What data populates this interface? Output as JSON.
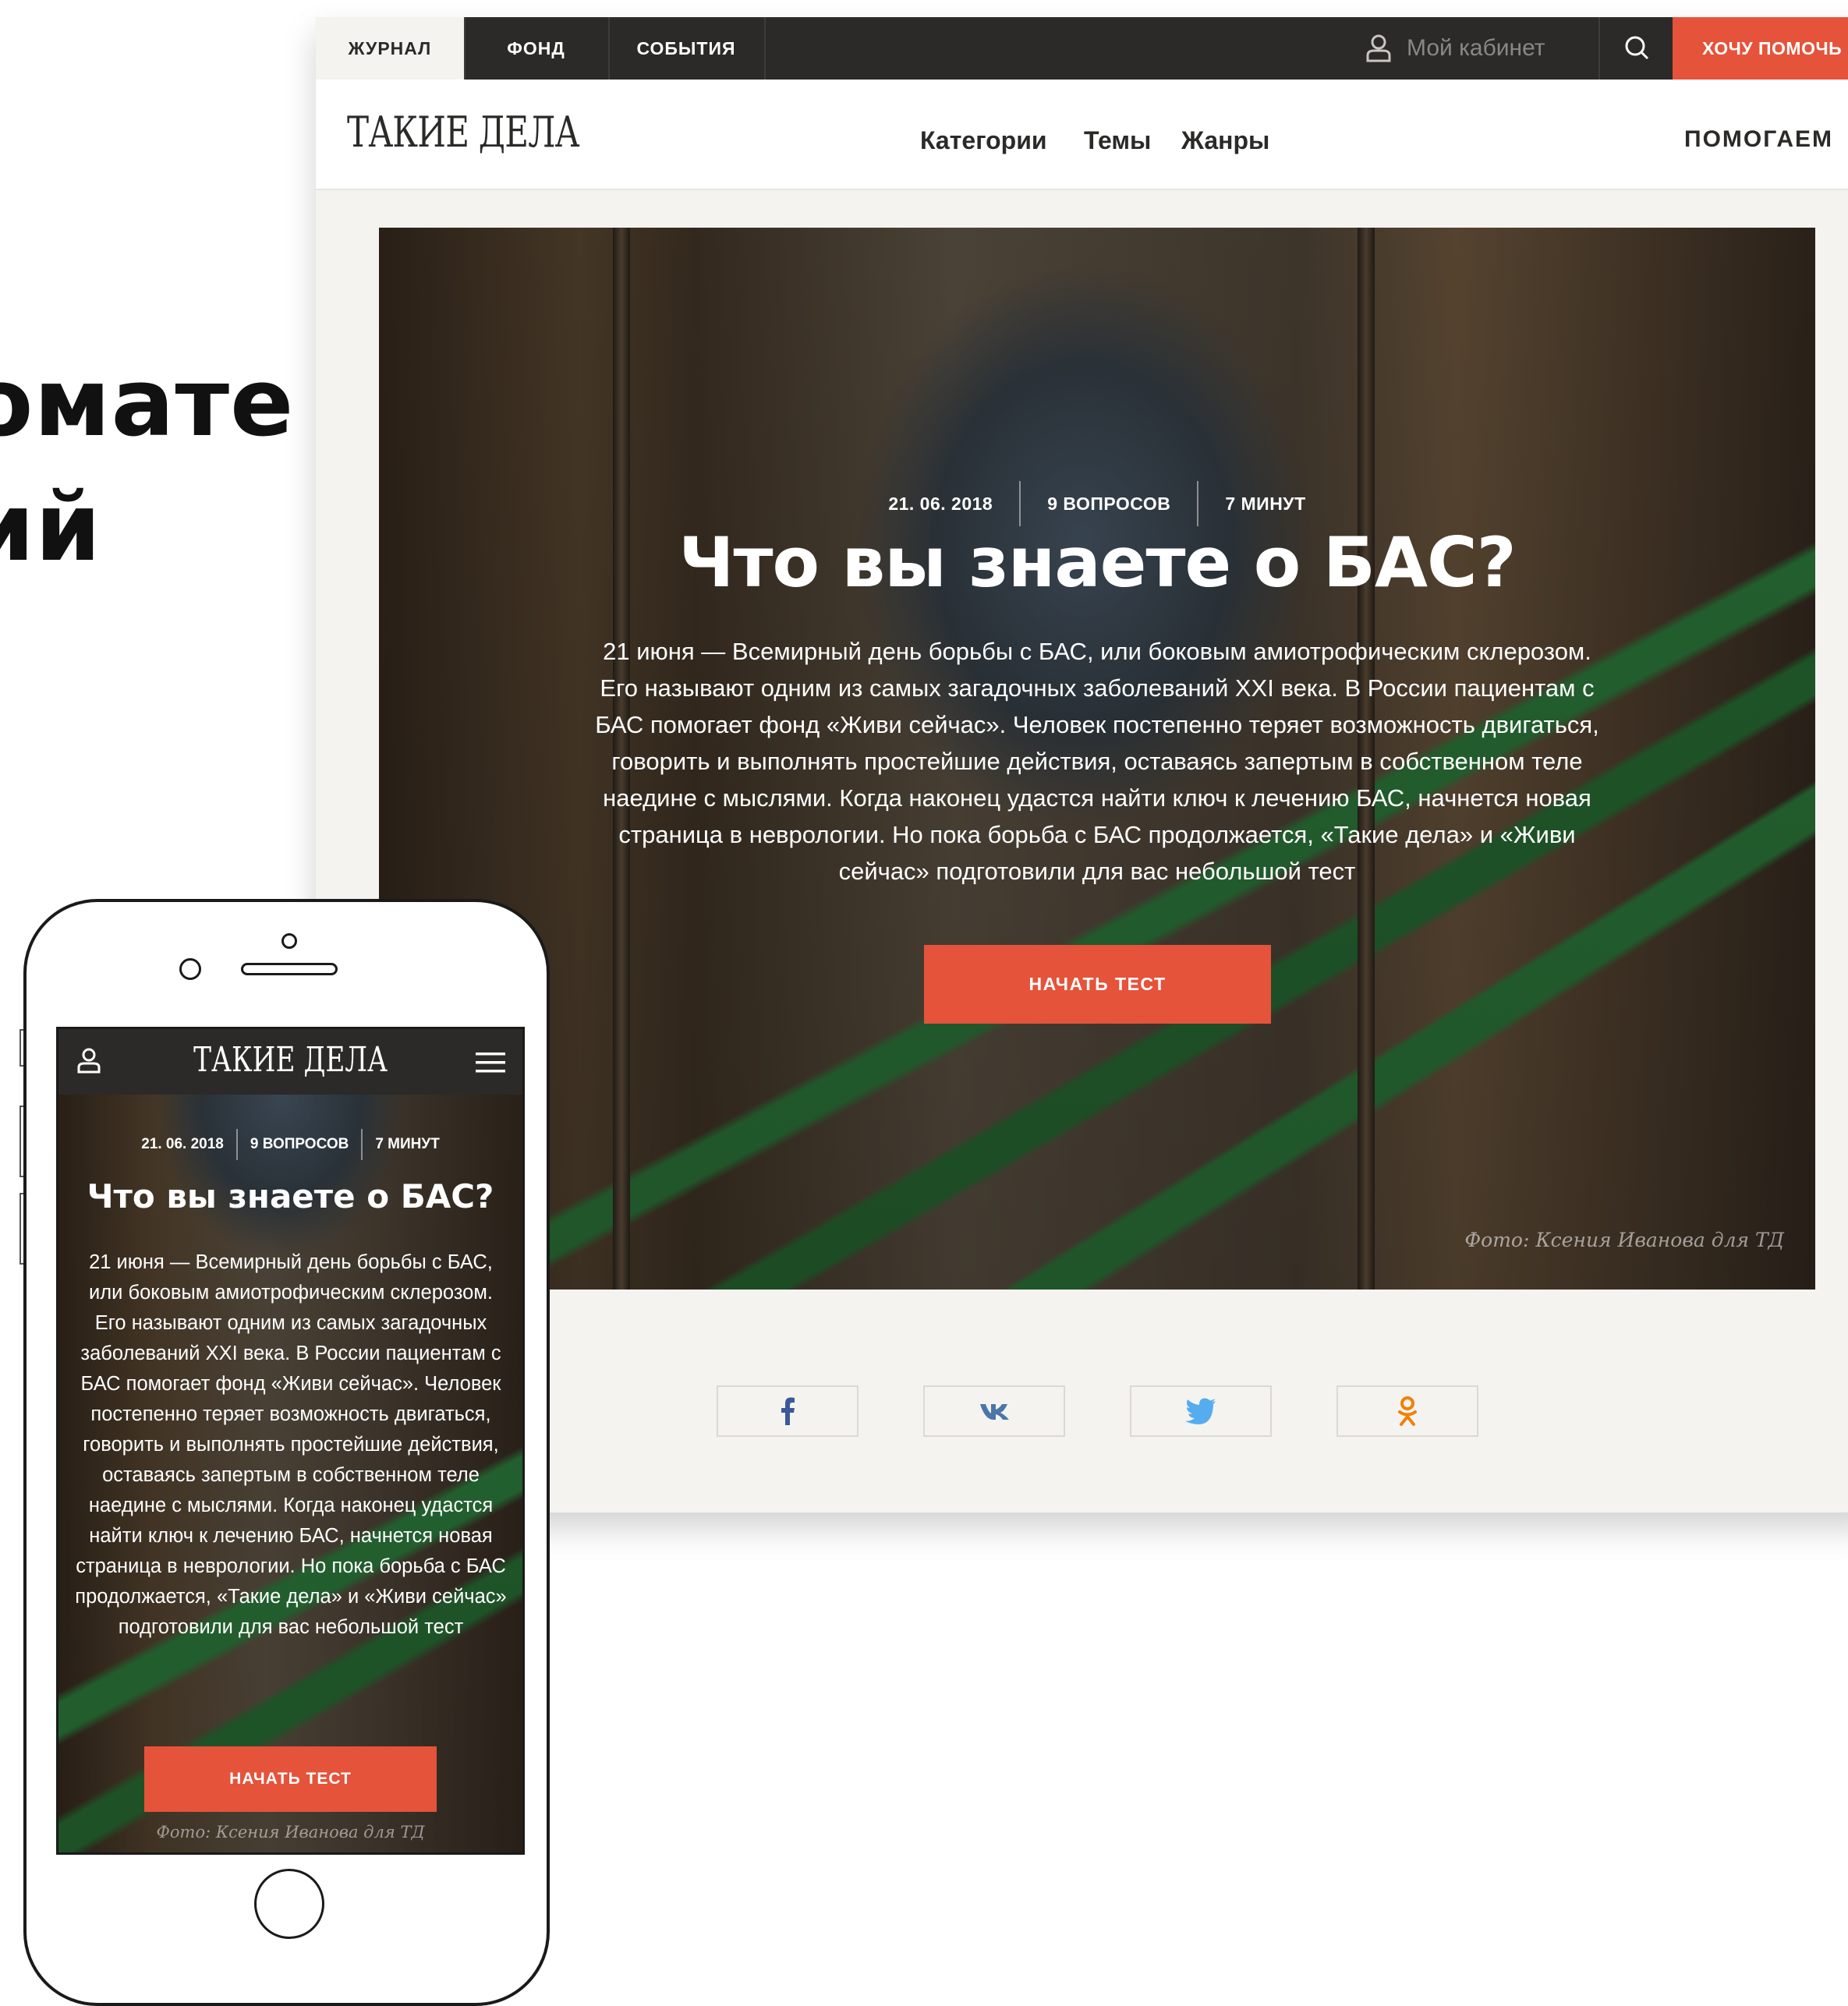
{
  "background_heading": {
    "line1": "омате",
    "line2": "ий"
  },
  "desktop": {
    "top_tabs": [
      "ЖУРНАЛ",
      "ФОНД",
      "СОБЫТИЯ"
    ],
    "cabinet_label": "Мой кабинет",
    "help_button": "ХОЧУ ПОМОЧЬ",
    "logo": "ТАКИЕ ДЕЛА",
    "nav": [
      "Категории",
      "Темы",
      "Жанры"
    ],
    "nav_right": "ПОМОГАЕМ",
    "hero": {
      "date": "21. 06. 2018",
      "questions": "9 ВОПРОСОВ",
      "duration": "7 МИНУТ",
      "title": "Что вы знаете о БАС?",
      "description": "21 июня — Всемирный день борьбы с БАС, или боковым амиотрофическим склерозом. Его называют одним из самых загадочных заболеваний XXI века. В России пациентам с БАС помогает фонд «Живи сейчас». Человек постепенно теряет возможность двигаться, говорить и выполнять простейшие действия, оставаясь запертым в собственном теле наедине с мыслями. Когда наконец удастся найти ключ к лечению БАС, начнется новая страница в неврологии. Но пока борьба с БАС продолжается, «Такие дела» и «Живи сейчас» подготовили для вас небольшой тест",
      "cta": "НАЧАТЬ ТЕСТ",
      "photo_credit": "Фото: Ксения Иванова для ТД"
    },
    "share_icons": [
      "facebook-icon",
      "vk-icon",
      "twitter-icon",
      "odnoklassniki-icon"
    ]
  },
  "mobile": {
    "logo": "ТАКИЕ ДЕЛА",
    "date": "21. 06. 2018",
    "questions": "9 ВОПРОСОВ",
    "duration": "7 МИНУТ",
    "title": "Что вы знаете о БАС?",
    "description": "21 июня — Всемирный день борьбы с БАС, или боковым амиотрофическим склерозом. Его называют одним из самых загадочных заболеваний XXI века. В России пациентам с БАС помогает фонд «Живи сейчас». Человек постепенно теряет возможность двигаться, говорить и выполнять простейшие действия, оставаясь запертым в собственном теле наедине с мыслями. Когда наконец удастся найти ключ к лечению БАС, начнется новая страница в неврологии. Но пока борьба с БАС продолжается, «Такие дела» и «Живи сейчас» подготовили для вас небольшой тест",
    "cta": "НАЧАТЬ ТЕСТ",
    "photo_credit": "Фото: Ксения Иванова для ТД"
  },
  "colors": {
    "accent": "#e5533a",
    "dark": "#2b2a28",
    "page_bg": "#f4f3f0",
    "facebook": "#3b5998",
    "vk": "#4a76a8",
    "twitter": "#55acee",
    "odnoklassniki": "#ee8208"
  }
}
